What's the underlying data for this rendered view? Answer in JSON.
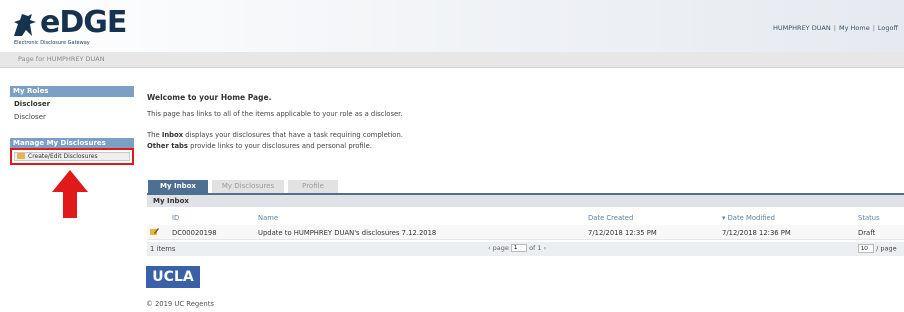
{
  "header": {
    "logo_text": "eDGE",
    "logo_subtitle": "Electronic Disclosure Gateway",
    "user_name": "HUMPHREY DUAN",
    "my_home": "My Home",
    "logoff": "Logoff",
    "separator": "|"
  },
  "subbar": {
    "page_for": "Page for HUMPHREY DUAN"
  },
  "sidebar": {
    "roles_title": "My Roles",
    "role_active": "Discloser",
    "role_item": "Discloser",
    "manage_title": "Manage My Disclosures",
    "create_edit_label": "Create/Edit Disclosures",
    "highlight_color": "#e01a1a"
  },
  "main": {
    "welcome": "Welcome to your Home Page.",
    "intro": "This page has links to all of the items applicable to your role as a discloser.",
    "inbox_keyword": "Inbox",
    "inbox_pre": "The ",
    "inbox_rest": " displays your disclosures that have a task requiring completion.",
    "other_keyword": "Other tabs",
    "other_rest": " provide links to your disclosures and personal profile."
  },
  "tabs": [
    {
      "label": "My Inbox",
      "active": true
    },
    {
      "label": "My Disclosures",
      "active": false
    },
    {
      "label": "Profile",
      "active": false
    }
  ],
  "inbox": {
    "title": "My Inbox",
    "columns": [
      "ID",
      "Name",
      "Date Created",
      "▾ Date Modified",
      "Status"
    ],
    "rows": [
      {
        "id": "DC00020198",
        "name": "Update to HUMPHREY DUAN's disclosures 7.12.2018",
        "date_created": "7/12/2018 12:35 PM",
        "date_modified": "7/12/2018 12:36 PM",
        "status": "Draft"
      }
    ],
    "items_count": "1 items",
    "pager_prev": "‹ page",
    "page_value": "1",
    "page_of": "of 1 ›",
    "per_page_value": "10",
    "per_page_label": "/ page"
  },
  "footer": {
    "logo": "UCLA",
    "copyright": "© 2019 UC Regents"
  },
  "colors": {
    "accent": "#4f6f92",
    "sidebar_head": "#7c9fc6",
    "arrow": "#e01a1a",
    "ucla_blue": "#3a61a8"
  }
}
